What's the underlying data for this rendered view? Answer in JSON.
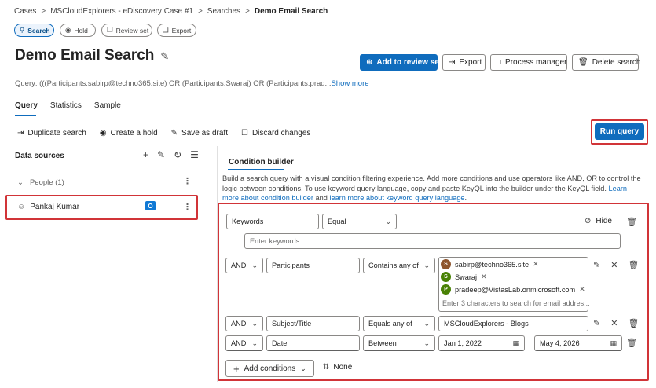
{
  "breadcrumb": [
    "Cases",
    "MSCloudExplorers - eDiscovery Case #1",
    "Searches",
    "Demo Email Search"
  ],
  "pills": {
    "search": "Search",
    "hold": "Hold",
    "review_set": "Review set",
    "export": "Export"
  },
  "page_title": "Demo Email Search",
  "actions": {
    "add_review": "Add to review set",
    "export": "Export",
    "process": "Process manager",
    "delete": "Delete search"
  },
  "query": {
    "label": "Query:",
    "text": "(((Participants:sabirp@techno365.site) OR (Participants:Swaraj) OR (Participants:prad...",
    "more": "Show more"
  },
  "tabs": [
    "Query",
    "Statistics",
    "Sample"
  ],
  "toolbar": {
    "duplicate": "Duplicate search",
    "create_hold": "Create a hold",
    "save_draft": "Save as draft",
    "discard": "Discard changes",
    "run": "Run query"
  },
  "sources": {
    "title": "Data sources",
    "people": "People (1)",
    "person": "Pankaj Kumar"
  },
  "builder": {
    "tab": "Condition builder",
    "desc": "Build a search query with a visual condition filtering experience. Add more conditions and use operators like AND, OR to control the logic between conditions. To use keyword query language, copy and paste KeyQL into the builder under the KeyQL field.",
    "link1": "Learn more about condition builder",
    "and": "and",
    "link2": "learn more about keyword query language",
    "hide": "Hide",
    "add_conditions": "Add conditions",
    "none": "None"
  },
  "conditions": {
    "kw": {
      "field": "Keywords",
      "op": "Equal",
      "placeholder": "Enter keywords"
    },
    "participants": {
      "logic": "AND",
      "field": "Participants",
      "op": "Contains any of",
      "placeholder": "Enter 3 characters to search for email addres...",
      "chips": [
        {
          "initial": "S",
          "text": "sabirp@techno365.site",
          "color": "#8e562e"
        },
        {
          "initial": "S",
          "text": "Swaraj",
          "color": "#498205"
        },
        {
          "initial": "P",
          "text": "pradeep@VistasLab.onmicrosoft.com",
          "color": "#498205"
        }
      ]
    },
    "subject": {
      "logic": "AND",
      "field": "Subject/Title",
      "op": "Equals any of",
      "value": "MSCloudExplorers - Blogs"
    },
    "date": {
      "logic": "AND",
      "field": "Date",
      "op": "Between",
      "from": "Jan 1, 2022",
      "to": "May 4, 2026"
    }
  }
}
